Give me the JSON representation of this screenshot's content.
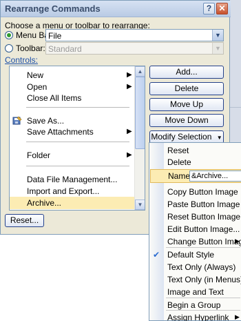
{
  "dialog": {
    "title": "Rearrange Commands",
    "help_label": "?",
    "close_label": "✕",
    "choose_prompt": "Choose a menu or toolbar to rearrange:",
    "menu_bar_label": "Menu Bar:",
    "menu_bar_value": "File",
    "toolbar_label": "Toolbar:",
    "toolbar_value": "Standard",
    "controls_label": "Controls:",
    "reset_button": "Reset..."
  },
  "controls_list": [
    {
      "label": "New",
      "submenu": true
    },
    {
      "label": "Open",
      "submenu": true
    },
    {
      "label": "Close All Items",
      "submenu": false
    },
    {
      "label": "Save As...",
      "submenu": false
    },
    {
      "label": "Save Attachments",
      "submenu": true
    },
    {
      "label": "Folder",
      "submenu": true
    },
    {
      "label": "Data File Management...",
      "submenu": false
    },
    {
      "label": "Import and Export...",
      "submenu": false
    },
    {
      "label": "Archive...",
      "submenu": false,
      "selected": true
    }
  ],
  "side_buttons": {
    "add": "Add...",
    "delete": "Delete",
    "move_up": "Move Up",
    "move_down": "Move Down",
    "modify_selection": "Modify Selection"
  },
  "modify_menu": {
    "reset": "Reset",
    "delete": "Delete",
    "name_label": "Name:",
    "name_value": "&Archive...",
    "copy_button_image": "Copy Button Image",
    "paste_button_image": "Paste Button Image",
    "reset_button_image": "Reset Button Image",
    "edit_button_image": "Edit Button Image...",
    "change_button_image": "Change Button Image",
    "default_style": "Default Style",
    "text_only_always": "Text Only (Always)",
    "text_only_menus": "Text Only (in Menus)",
    "image_and_text": "Image and Text",
    "begin_group": "Begin a Group",
    "assign_hyperlink": "Assign Hyperlink"
  },
  "icons": {
    "help": "help-icon",
    "close": "close-icon",
    "save_as": "save-as-icon",
    "checkmark": "checkmark-icon"
  },
  "colors": {
    "dialog_bg": "#ece9d8",
    "selection": "#fcecb3",
    "link": "#1b4fa8"
  }
}
